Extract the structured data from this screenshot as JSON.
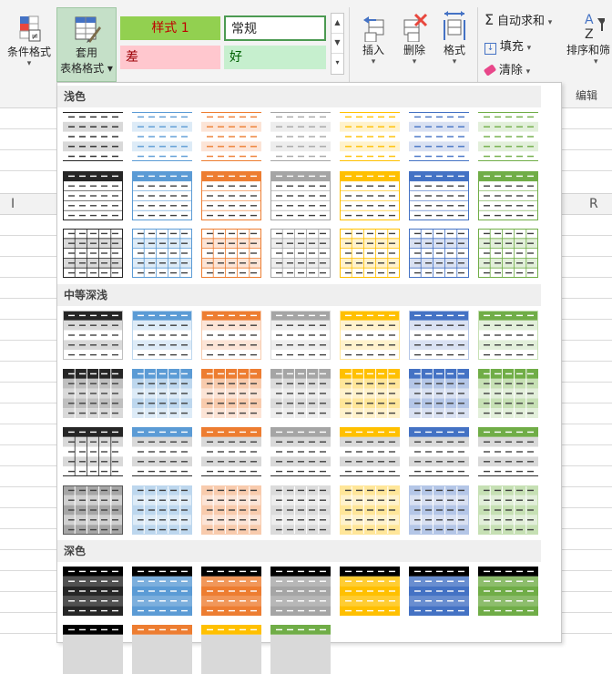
{
  "ribbon": {
    "conditional_format_label": "条件格式",
    "format_as_table_line1": "套用",
    "format_as_table_line2": "表格格式",
    "cell_styles": {
      "style1": "样式 1",
      "normal": "常规",
      "bad": "差",
      "good": "好"
    },
    "insert_label": "插入",
    "delete_label": "删除",
    "format_label": "格式",
    "autosum_label": "自动求和",
    "fill_label": "填充",
    "clear_label": "清除",
    "sort_filter_label": "排序和筛",
    "editing_group_label": "编辑"
  },
  "columns": {
    "col_i": "I",
    "col_r": "R"
  },
  "gallery": {
    "sections": [
      {
        "title": "浅色"
      },
      {
        "title": "中等深浅"
      },
      {
        "title": "深色"
      }
    ]
  },
  "colors": {
    "black": "#262626",
    "blue": "#5b9bd5",
    "orange": "#ed7d31",
    "gray": "#a5a5a5",
    "gold": "#ffc000",
    "darkblue": "#4472c4",
    "green": "#70ad47",
    "selected_button_bg": "#c5e0c8"
  }
}
